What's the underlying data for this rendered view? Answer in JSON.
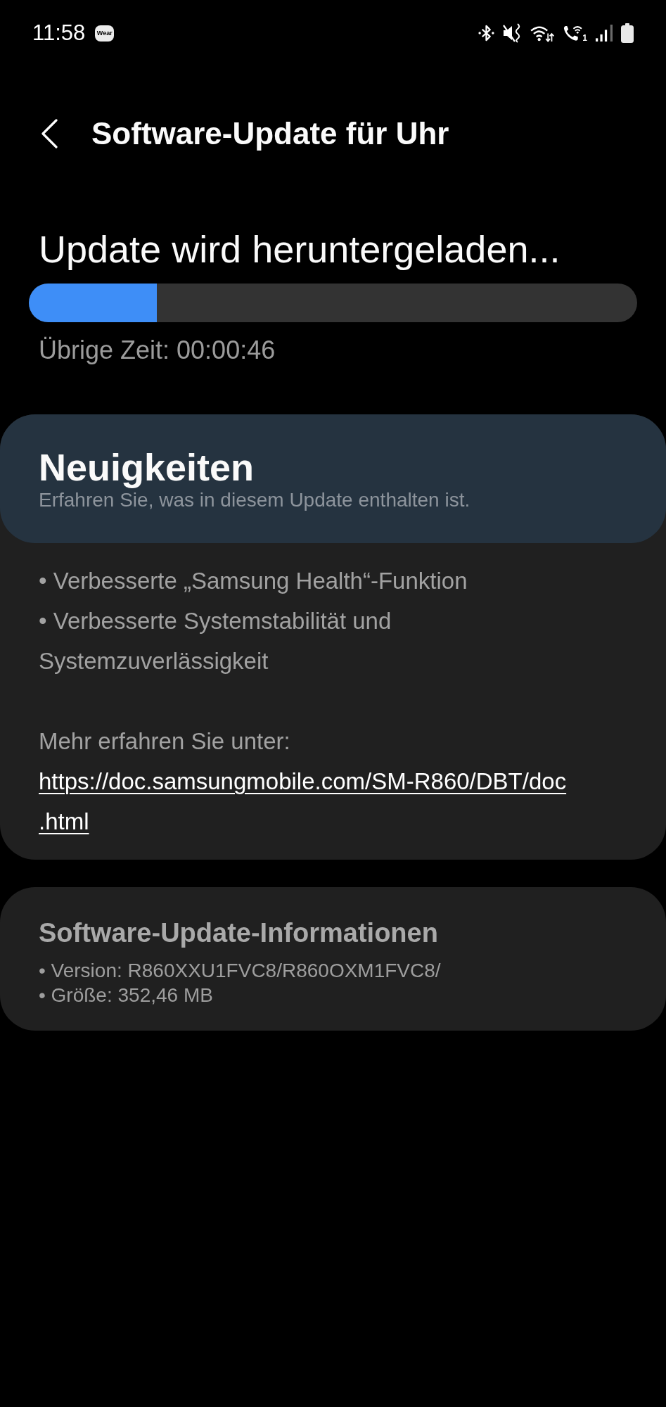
{
  "status_bar": {
    "time": "11:58",
    "notification_badge": "Wear",
    "sim_label": "1"
  },
  "header": {
    "title": "Software-Update für Uhr"
  },
  "download": {
    "heading": "Update wird heruntergeladen...",
    "progress": {
      "level": 0.21
    },
    "remaining": "Übrige Zeit: 00:00:46"
  },
  "whats_new": {
    "title": "Neuigkeiten",
    "subtitle": "Erfahren Sie, was in diesem Update enthalten ist.",
    "items": [
      "• Verbesserte „Samsung Health“-Funktion",
      "• Verbesserte Systemstabilität und Systemzuverlässigkeit"
    ],
    "more_label": "Mehr erfahren Sie unter:",
    "link": "https://doc.samsungmobile.com/SM-R860/DBT/doc.html"
  },
  "update_info": {
    "title": "Software-Update-Informationen",
    "lines": [
      "• Version: R860XXU1FVC8/R860OXM1FVC8/",
      "• Größe: 352,46 MB"
    ]
  }
}
